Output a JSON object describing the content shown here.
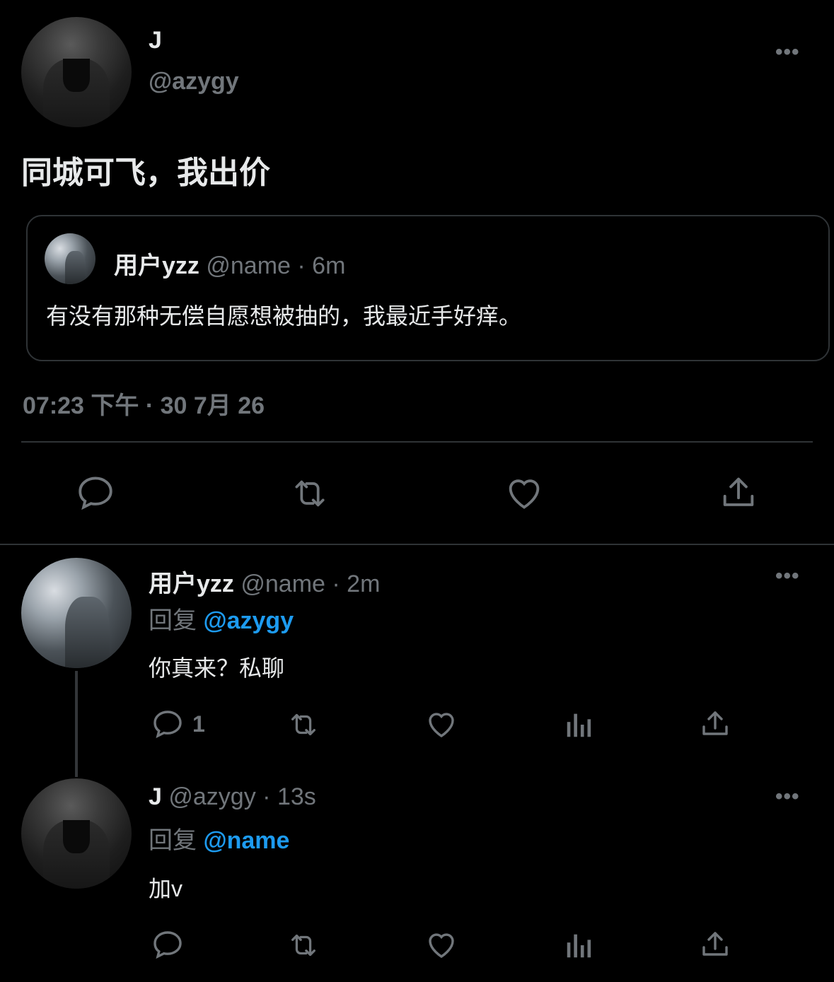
{
  "main_tweet": {
    "display_name": "J",
    "handle": "@azygy",
    "text": "同城可飞，我出价",
    "timestamp": "07:23 下午 · 30 7月 26",
    "quoted": {
      "display_name": "用户yzz",
      "handle": "@name",
      "time": "· 6m",
      "text": "有没有那种无偿自愿想被抽的，我最近手好痒。"
    }
  },
  "replies": [
    {
      "display_name": "用户yzz",
      "handle": "@name",
      "time": "· 2m",
      "reply_prefix": "回复",
      "reply_to": "@azygy",
      "text": "你真来？私聊",
      "reply_count": "1"
    },
    {
      "display_name": "J",
      "handle": "@azygy",
      "time": "· 13s",
      "reply_prefix": "回复",
      "reply_to": "@name",
      "text": "加v"
    }
  ],
  "more_glyph": "•••",
  "colors": {
    "background": "#000000",
    "text": "#e7e9ea",
    "muted": "#71767b",
    "link": "#1d9bf0",
    "divider": "#2f3336"
  }
}
